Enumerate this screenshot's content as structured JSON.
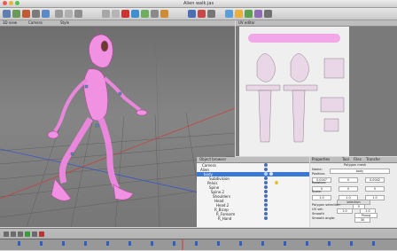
{
  "window": {
    "title": "Alien walk.jas"
  },
  "viewport": {
    "menu_items": [
      "3D view",
      "Camera",
      "Style"
    ]
  },
  "uv_editor": {
    "label": "UV editor"
  },
  "object_browser": {
    "label": "Object browser",
    "rows": [
      {
        "name": "Camera"
      },
      {
        "name": "Alien"
      },
      {
        "name": "body"
      },
      {
        "name": "Subdivision"
      },
      {
        "name": "Pelvis"
      },
      {
        "name": "Spine"
      },
      {
        "name": "Spine.2"
      },
      {
        "name": "Shoulders"
      },
      {
        "name": "Head"
      },
      {
        "name": "Head.2"
      },
      {
        "name": "R_Bicep"
      },
      {
        "name": "R_Forearm"
      },
      {
        "name": "R_Hand"
      }
    ]
  },
  "properties": {
    "tabs": [
      "Properties",
      "Tool",
      "Files",
      "Transfer"
    ],
    "section": "Polygon mesh",
    "name_label": "Name:",
    "name_value": "body",
    "position_label": "Position:",
    "position_values": [
      "0.0047",
      "0",
      "0.0042"
    ],
    "rotation_label": "Rotation:",
    "rotation_values": [
      "0",
      "0",
      "0"
    ],
    "scale_label": "Scale:",
    "scale_values": [
      "1.0",
      "1.0",
      "1.0"
    ],
    "selection_label": "selection",
    "polygon_selection_label": "Polygon selection:",
    "polygon_selection_value": "0",
    "uv_set_label": "UV set:",
    "uv_set_values": [
      "1.0",
      "1.0"
    ],
    "smooth_label": "Smooth",
    "smooth_value": "Phong",
    "smooth_angle_label": "Smooth angle:",
    "smooth_angle_value": "30"
  },
  "colors": {
    "mesh_pink": "#e87ad8",
    "selected_row": "#3a78d6"
  }
}
